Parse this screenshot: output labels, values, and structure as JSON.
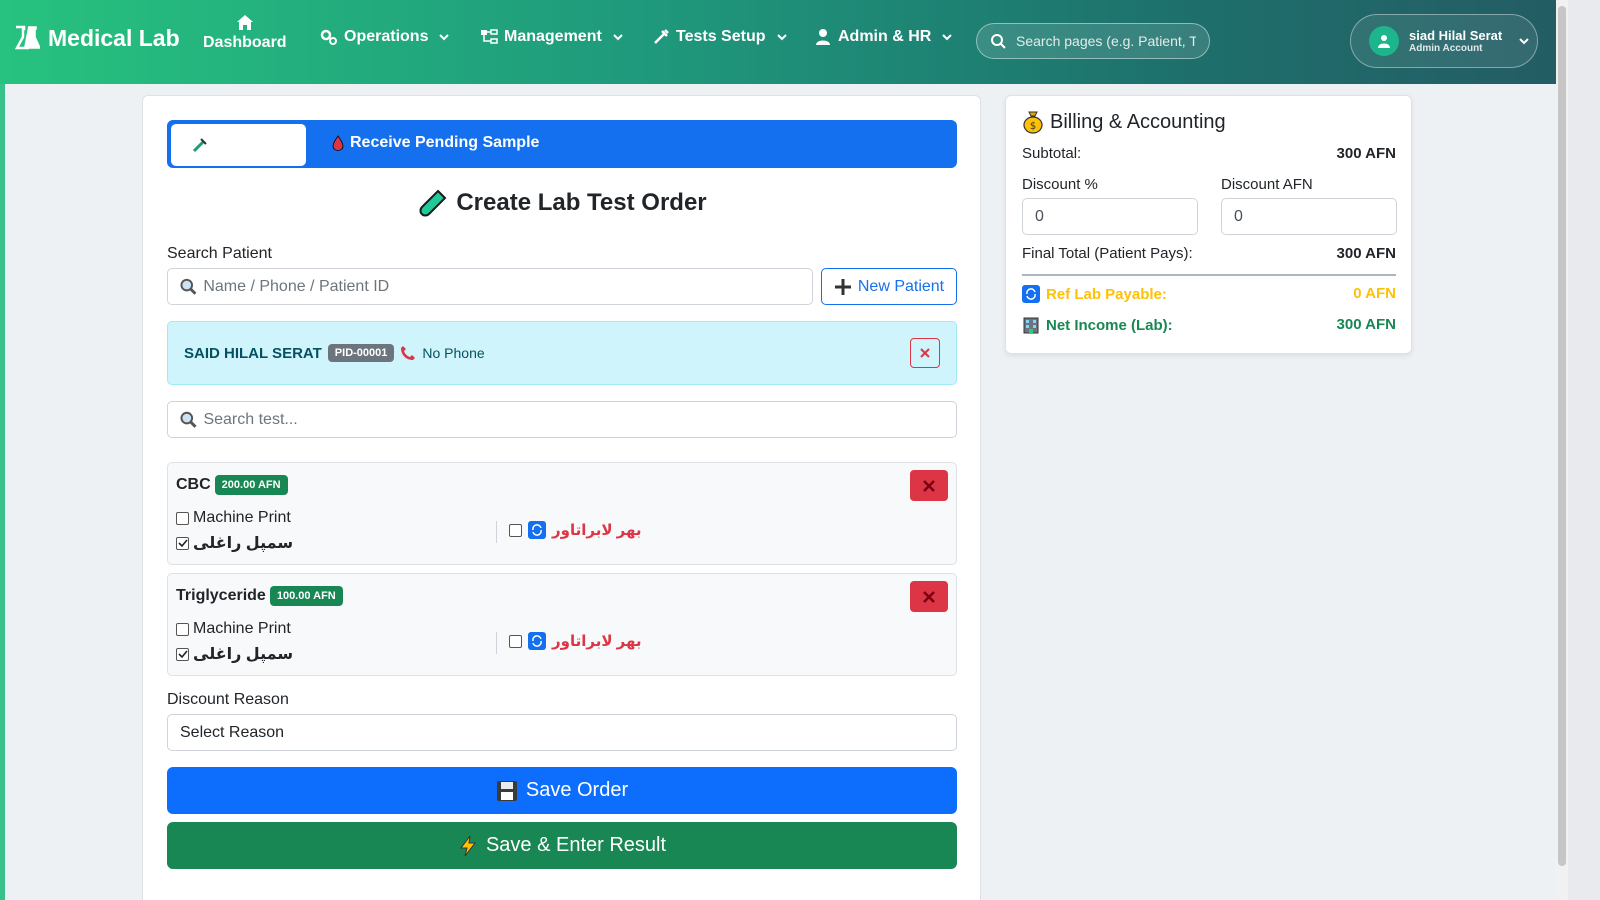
{
  "nav": {
    "brand": "Medical Lab",
    "dashboard": "Dashboard",
    "operations": "Operations",
    "management": "Management",
    "tests_setup": "Tests Setup",
    "admin_hr": "Admin & HR",
    "search_placeholder": "Search pages (e.g. Patient, T",
    "user_name": "siad Hilal Serat",
    "user_role": "Admin Account"
  },
  "tabs": {
    "receive_pending": "Receive Pending Sample"
  },
  "order": {
    "title": "Create Lab Test Order",
    "search_patient_label": "Search Patient",
    "search_patient_placeholder": "Name / Phone / Patient ID",
    "new_patient": "New Patient",
    "patient_name": "SAID HILAL SERAT",
    "patient_id": "PID-00001",
    "patient_phone": "No Phone",
    "search_test_placeholder": "Search test...",
    "tests": [
      {
        "name": "CBC",
        "price": "200.00 AFN",
        "machine_print": "Machine Print",
        "sample": "سمپل راغلی",
        "ref_lab": "بهر لابراتاور",
        "machine_print_checked": false,
        "sample_checked": true,
        "ref_checked": false
      },
      {
        "name": "Triglyceride",
        "price": "100.00 AFN",
        "machine_print": "Machine Print",
        "sample": "سمپل راغلی",
        "ref_lab": "بهر لابراتاور",
        "machine_print_checked": false,
        "sample_checked": true,
        "ref_checked": false
      }
    ],
    "discount_reason_label": "Discount Reason",
    "discount_reason_value": "Select Reason",
    "save_order": "Save Order",
    "save_enter_result": "Save & Enter Result"
  },
  "billing": {
    "title": "Billing & Accounting",
    "subtotal_label": "Subtotal:",
    "subtotal_value": "300 AFN",
    "discount_pct_label": "Discount %",
    "discount_pct_value": "0",
    "discount_afn_label": "Discount AFN",
    "discount_afn_value": "0",
    "final_total_label": "Final Total (Patient Pays):",
    "final_total_value": "300 AFN",
    "ref_payable_label": "Ref Lab Payable:",
    "ref_payable_value": "0 AFN",
    "net_income_label": "Net Income (Lab):",
    "net_income_value": "300 AFN"
  },
  "colors": {
    "primary": "#0d6efd",
    "success": "#198754",
    "danger": "#dc3545",
    "warning": "#ffc107",
    "info_bg": "#cff4fc"
  },
  "icons": [
    "flask-icon",
    "home-icon",
    "gears-icon",
    "sitemap-icon",
    "syringe-icon",
    "user-tie-icon",
    "search-icon",
    "user-icon",
    "blood-drop-icon",
    "test-tube-icon",
    "plus-icon",
    "phone-icon",
    "close-icon",
    "sync-icon",
    "floppy-disk-icon",
    "lightning-icon",
    "money-bag-icon",
    "building-icon"
  ]
}
